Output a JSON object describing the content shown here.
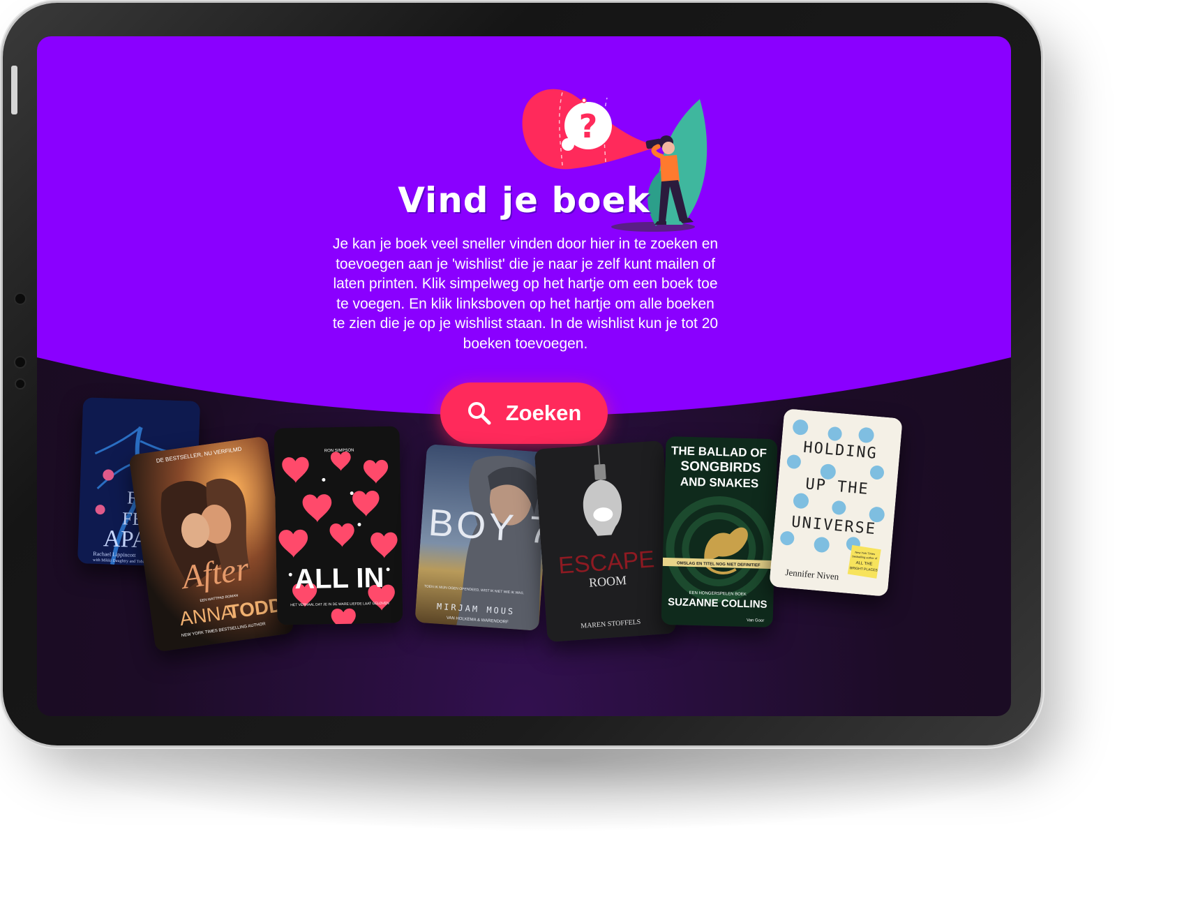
{
  "page": {
    "title": "Vind je boek",
    "description": "Je kan je boek veel sneller vinden door hier in te zoeken en toevoegen aan je 'wishlist' die je naar je zelf kunt mailen of laten printen. Klik simpelweg op het hartje om een boek toe te voegen. En klik linksboven op het hartje om alle boeken te zien die je op je wishlist staan. In de wishlist kun je tot 20 boeken toevoegen.",
    "search_label": "Zoeken",
    "search_icon": "search-icon",
    "illustration_icon": "question-mark-icon"
  },
  "colors": {
    "hero": "#8a00ff",
    "accent": "#ff2a5b",
    "dark": "#1c0c26"
  },
  "books": [
    {
      "title": "Five Feet Apart",
      "cover_lines": [
        "FIVE",
        "FEET",
        "APART"
      ],
      "author": "Rachael Lippincott",
      "author_line2": "with Mikki Daughtry and Tobias"
    },
    {
      "title": "After",
      "tagline": "DE BESTSELLER, NU VERFILMD",
      "subtitle": "EEN WATTPAD ROMAN",
      "author_first": "ANNA",
      "author_last": "TODD",
      "note": "NEW YORK TIMES BESTSELLING AUTHOR"
    },
    {
      "title": "ALL IN",
      "author": "RON SIMPSON",
      "tagline": "HET VERHAAL DAT JE IN DE WARE LIEFDE LAAT GELOVEN"
    },
    {
      "title": "BOY 7",
      "blurb": "TOEN IK MIJN OGEN OPENDEED, WIST IK NIET WIE IK WAS.",
      "author": "MIRJAM MOUS",
      "publisher": "VAN HOLKEMA & WARENDORF"
    },
    {
      "title_line1": "ESCAPE",
      "title_line2": "ROOM",
      "author": "MAREN STOFFELS"
    },
    {
      "title_line1": "THE BALLAD OF",
      "title_line2": "SONGBIRDS",
      "title_line3": "AND SNAKES",
      "banner": "OMSLAG EN TITEL NOG NIET DEFINITIEF",
      "series": "EEN HONGERSPELEN BOEK",
      "author": "SUZANNE COLLINS",
      "publisher": "Van Goor"
    },
    {
      "title_line1": "HOLDING",
      "title_line2": "UP THE",
      "title_line3": "UNIVERSE",
      "author": "Jennifer Niven",
      "sticker_line1": "New York Times",
      "sticker_line2": "bestselling author of",
      "sticker_line3": "ALL THE",
      "sticker_line4": "BRIGHT PLACES"
    }
  ]
}
